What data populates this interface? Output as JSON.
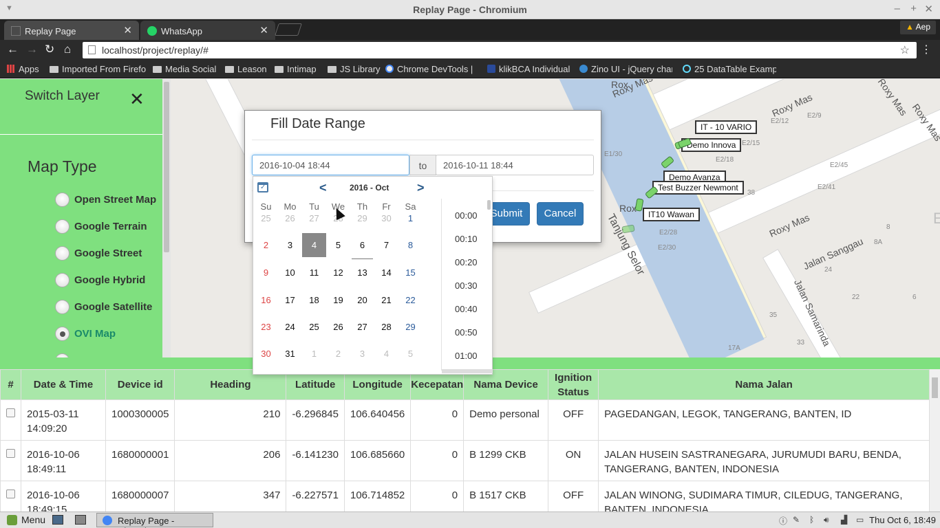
{
  "window": {
    "title": "Replay Page - Chromium"
  },
  "tabs": [
    {
      "label": "Replay Page",
      "active": true
    },
    {
      "label": "WhatsApp",
      "active": false
    }
  ],
  "extension_badge": "Aep",
  "address_bar": {
    "url": "localhost/project/replay/#"
  },
  "bookmarks": [
    "Apps",
    "Imported From Firefo",
    "Media Social",
    "Leason",
    "Intimap",
    "JS Library",
    "Chrome DevTools |",
    "klikBCA Individual",
    "Zino UI - jQuery char",
    "25 DataTable Examp"
  ],
  "sidebar": {
    "title": "Switch Layer",
    "close": "✕",
    "heading": "Map Type",
    "options": [
      {
        "label": "Open Street Map",
        "checked": false
      },
      {
        "label": "Google Terrain",
        "checked": false
      },
      {
        "label": "Google Street",
        "checked": false
      },
      {
        "label": "Google Hybrid",
        "checked": false
      },
      {
        "label": "Google Satellite",
        "checked": false
      },
      {
        "label": "OVI Map",
        "checked": true
      }
    ]
  },
  "map": {
    "streets": [
      "Roxy Mas",
      "Roxy Mas",
      "Roxy Mas",
      "Roxy Mas",
      "Roxy Mas",
      "Tanjung Selor",
      "Jalan Sanggau",
      "Jalan Samarinda",
      "Rox",
      "Rox"
    ],
    "blocks": [
      "E2/12",
      "E2/9",
      "E2/15",
      "E2/18",
      "E2/45",
      "E2/41",
      "E2/28",
      "E2/30",
      "E1/30",
      "38",
      "8",
      "8A",
      "24",
      "22",
      "6",
      "35",
      "33",
      "17A",
      "E"
    ],
    "vehicles": [
      "IT - 10 VARIO",
      "Demo Innova",
      "Demo Avanza",
      "Test Buzzer Newmont",
      "IT10  Wawan"
    ]
  },
  "modal": {
    "title": "Fill Date Range",
    "start_value": "2016-10-04 18:44",
    "to_label": "to",
    "end_value": "2016-10-11 18:44",
    "submit_label": "Submit",
    "cancel_label": "Cancel"
  },
  "datepicker": {
    "prev": "<",
    "next": ">",
    "month_label": "2016 - Oct",
    "weekdays": [
      "Su",
      "Mo",
      "Tu",
      "We",
      "Th",
      "Fr",
      "Sa"
    ],
    "weeks": [
      [
        "25",
        "26",
        "27",
        "28",
        "29",
        "30",
        "1"
      ],
      [
        "2",
        "3",
        "4",
        "5",
        "6",
        "7",
        "8"
      ],
      [
        "9",
        "10",
        "11",
        "12",
        "13",
        "14",
        "15"
      ],
      [
        "16",
        "17",
        "18",
        "19",
        "20",
        "21",
        "22"
      ],
      [
        "23",
        "24",
        "25",
        "26",
        "27",
        "28",
        "29"
      ],
      [
        "30",
        "31",
        "1",
        "2",
        "3",
        "4",
        "5"
      ]
    ],
    "selected_day": "4",
    "today_day": "6",
    "times": [
      "00:00",
      "00:10",
      "00:20",
      "00:30",
      "00:40",
      "00:50",
      "01:00"
    ]
  },
  "table": {
    "headers": [
      "#",
      "Date & Time",
      "Device id",
      "Heading",
      "Latitude",
      "Longitude",
      "Kecepatan",
      "Nama Device",
      "Ignition Status",
      "Nama Jalan"
    ],
    "rows": [
      {
        "datetime": "2015-03-11 14:09:20",
        "device_id": "1000300005",
        "heading": "210",
        "latitude": "-6.296845",
        "longitude": "106.640456",
        "kecepatan": "0",
        "nama_device": "Demo personal",
        "ignition": "OFF",
        "nama_jalan": "PAGEDANGAN, LEGOK, TANGERANG, BANTEN, ID"
      },
      {
        "datetime": "2016-10-06 18:49:11",
        "device_id": "1680000001",
        "heading": "206",
        "latitude": "-6.141230",
        "longitude": "106.685660",
        "kecepatan": "0",
        "nama_device": "B 1299 CKB",
        "ignition": "ON",
        "nama_jalan": "JALAN HUSEIN SASTRANEGARA, JURUMUDI BARU, BENDA, TANGERANG, BANTEN, INDONESIA"
      },
      {
        "datetime": "2016-10-06 18:49:15",
        "device_id": "1680000007",
        "heading": "347",
        "latitude": "-6.227571",
        "longitude": "106.714852",
        "kecepatan": "0",
        "nama_device": "B 1517 CKB",
        "ignition": "OFF",
        "nama_jalan": "JALAN WINONG, SUDIMARA TIMUR, CILEDUG, TANGERANG, BANTEN, INDONESIA"
      }
    ]
  },
  "taskbar": {
    "menu_label": "Menu",
    "task_label": "Replay Page - Chromi...",
    "clock": "Thu Oct  6, 18:49"
  }
}
